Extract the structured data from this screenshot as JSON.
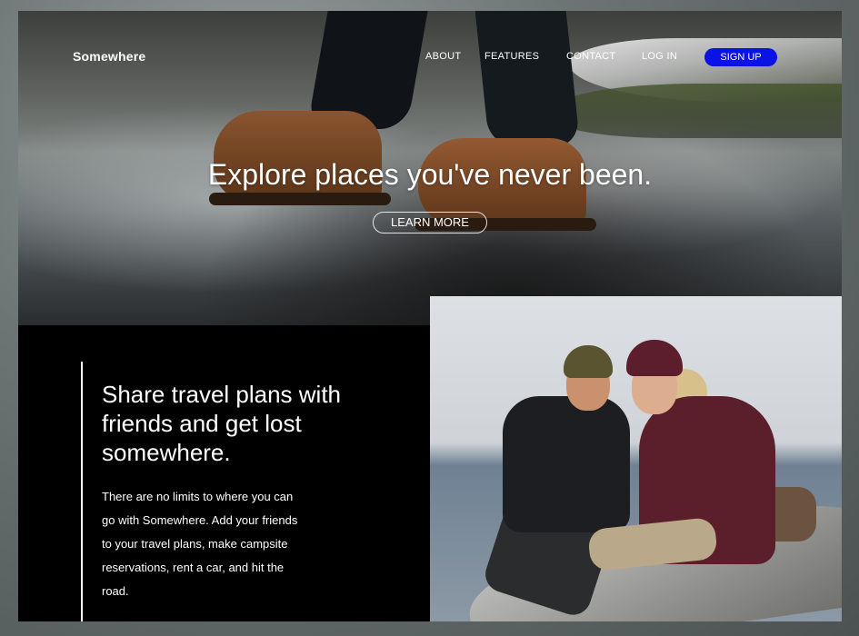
{
  "header": {
    "logo": "Somewhere",
    "nav": [
      "ABOUT",
      "FEATURES",
      "CONTACT",
      "LOG IN"
    ],
    "signup_label": "SIGN UP"
  },
  "hero": {
    "headline": "Explore places you've never been.",
    "cta_label": "LEARN MORE"
  },
  "feature": {
    "title": "Share travel plans with friends and get lost somewhere.",
    "body": "There are no limits to where you can go with Somewhere. Add your friends to your travel plans, make campsite reservations, rent a car, and hit the road."
  },
  "colors": {
    "signup_button": "#0b12e6",
    "panel_background": "#000000",
    "text": "#ffffff"
  }
}
